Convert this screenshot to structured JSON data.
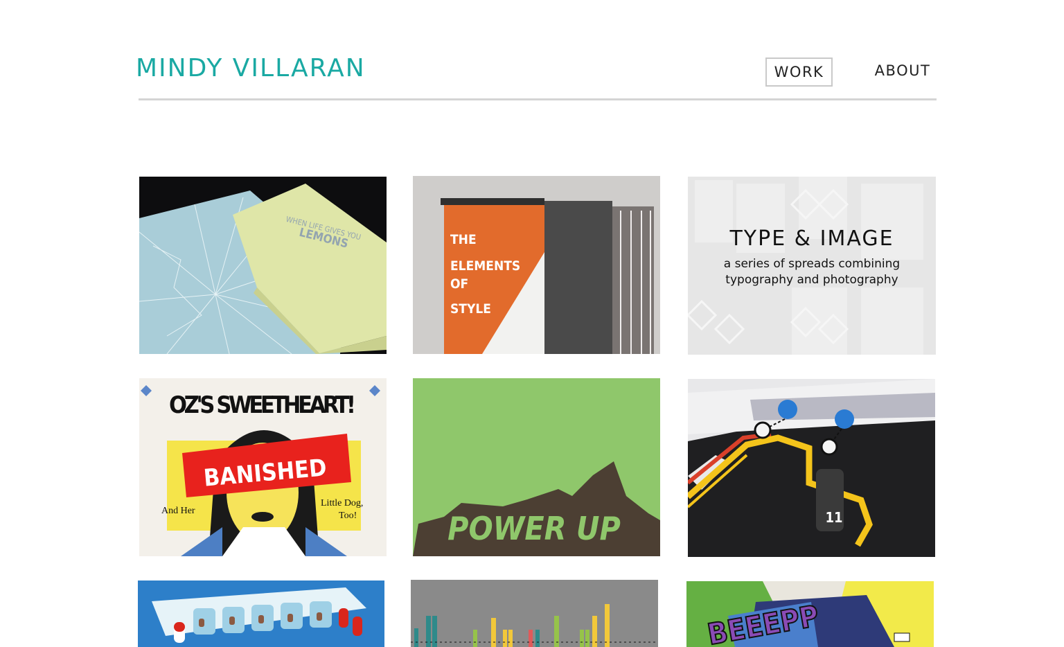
{
  "site": {
    "title": "MINDY VILLARAN"
  },
  "nav": {
    "items": [
      {
        "label": "WORK",
        "active": true
      },
      {
        "label": "ABOUT",
        "active": false
      }
    ]
  },
  "colors": {
    "brand": "#1aa9a3",
    "active_border": "#c9c9c9",
    "rule": "#d4d4d4"
  },
  "tiles": [
    {
      "image_text": "WHEN LIFE GIVES YOU",
      "image_text2": "LEMONS"
    },
    {
      "image_lines": [
        "THE",
        "ELEMENTS",
        "OF",
        "STYLE"
      ]
    },
    {
      "overlay_title": "TYPE & IMAGE",
      "overlay_subtitle": "a series of spreads combining typography and photography"
    },
    {
      "image_text": "OZ'S SWEETHEART!",
      "image_text2": "BANISHED",
      "image_text3": "And Her",
      "image_text4": "Little Dog,",
      "image_text5": "Too!"
    },
    {
      "image_text": "POWER UP"
    },
    {
      "image_text": "11"
    },
    {
      "image_text": ""
    },
    {
      "image_text": ""
    },
    {
      "image_text": "BEEEPP"
    }
  ]
}
